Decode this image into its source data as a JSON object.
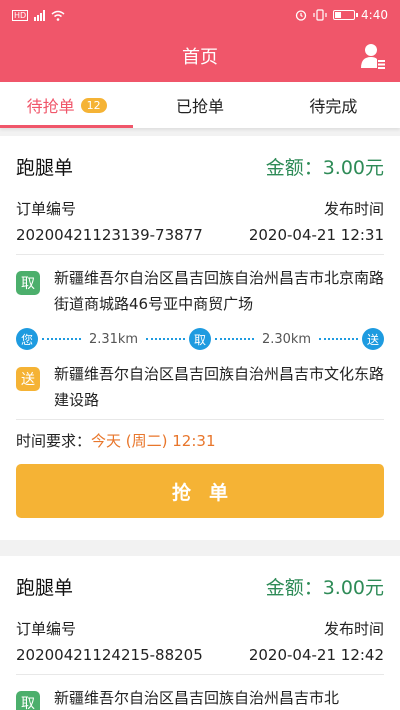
{
  "status_bar": {
    "left_icons": [
      "hd-icon",
      "signal-4g-icon",
      "wifi-icon"
    ],
    "right_icons": [
      "alarm-icon",
      "vibrate-icon",
      "battery-icon"
    ],
    "time": "4:40"
  },
  "header": {
    "title": "首页",
    "bg_color": "#f0566a"
  },
  "tabs": [
    {
      "label": "待抢单",
      "badge": "12",
      "active": true
    },
    {
      "label": "已抢单",
      "active": false
    },
    {
      "label": "待完成",
      "active": false
    }
  ],
  "orders": [
    {
      "type": "跑腿单",
      "amount": "金额：3.00元",
      "order_no_label": "订单编号",
      "order_no": "20200421123139-73877",
      "publish_label": "发布时间",
      "publish_time": "2020-04-21 12:31",
      "pickup_tag": "取",
      "pickup_address": "新疆维吾尔自治区昌吉回族自治州昌吉市北京南路街道商城路46号亚中商贸广场",
      "route": {
        "you": "您",
        "dist1": "2.31km",
        "pickup": "取",
        "dist2": "2.30km",
        "deliver": "送"
      },
      "deliver_tag": "送",
      "deliver_address": "新疆维吾尔自治区昌吉回族自治州昌吉市文化东路建设路",
      "time_label": "时间要求：",
      "time_value": "今天 (周二) 12:31",
      "grab_label": "抢单"
    },
    {
      "type": "跑腿单",
      "amount": "金额：3.00元",
      "order_no_label": "订单编号",
      "order_no": "20200421124215-88205",
      "publish_label": "发布时间",
      "publish_time": "2020-04-21 12:42",
      "pickup_tag": "取",
      "pickup_address": "新疆维吾尔自治区昌吉回族自治州昌吉市北"
    }
  ]
}
